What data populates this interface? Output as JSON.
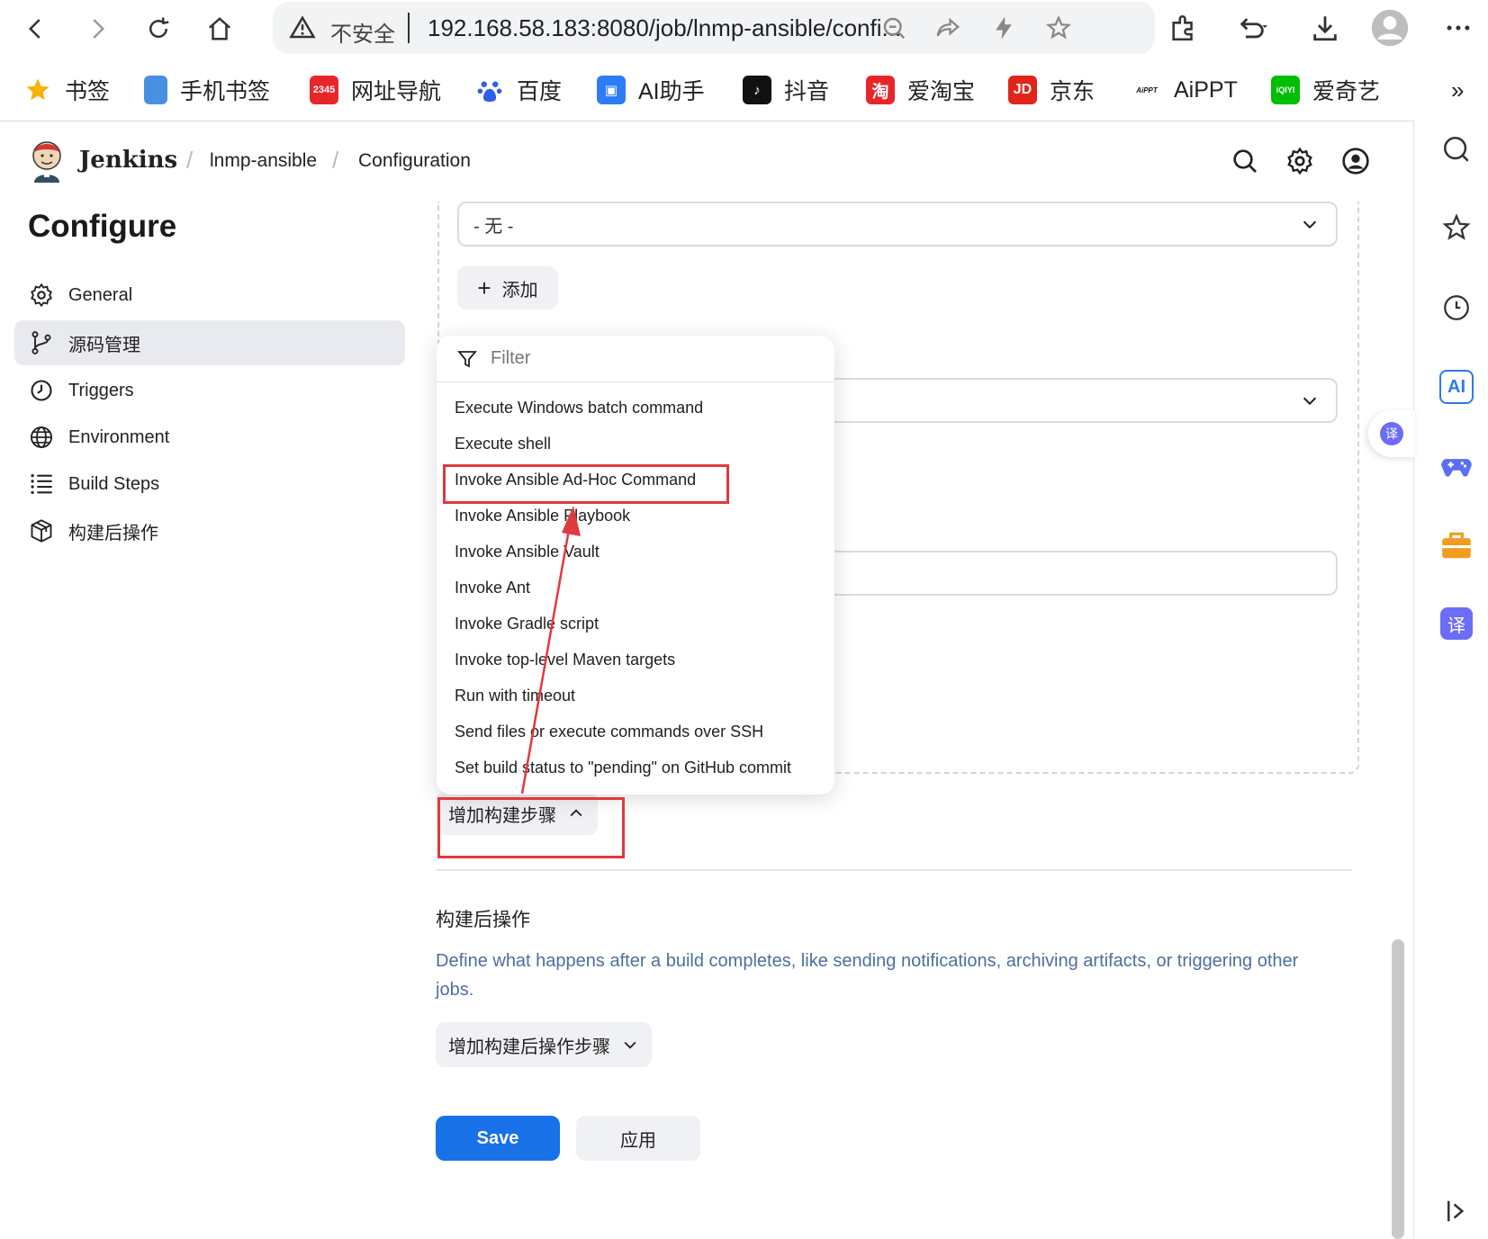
{
  "browser": {
    "insecure_label": "不安全",
    "url": "192.168.58.183:8080/job/lnmp-ansible/confi...",
    "bookmarks": [
      {
        "label": "书签",
        "icon": "star-icon"
      },
      {
        "label": "手机书签",
        "icon": "phone-icon"
      },
      {
        "label": "网址导航",
        "icon": "nav-icon",
        "badge": "2345"
      },
      {
        "label": "百度",
        "icon": "baidu-icon"
      },
      {
        "label": "AI助手",
        "icon": "ai-assistant-icon"
      },
      {
        "label": "抖音",
        "icon": "douyin-icon"
      },
      {
        "label": "爱淘宝",
        "icon": "taobao-icon",
        "badge": "淘"
      },
      {
        "label": "京东",
        "icon": "jd-icon",
        "badge": "JD"
      },
      {
        "label": "AiPPT",
        "icon": "aippt-icon",
        "badge": "AiPPT"
      },
      {
        "label": "爱奇艺",
        "icon": "iqiyi-icon",
        "badge": "iQIYI"
      }
    ],
    "more_label": "»",
    "sidebar_ai_label": "AI",
    "sidebar_translate_label": "译"
  },
  "jenkins": {
    "app_name": "Jenkins",
    "breadcrumb": [
      "lnmp-ansible",
      "Configuration"
    ]
  },
  "page": {
    "title": "Configure",
    "nav": [
      {
        "label": "General",
        "icon": "gear-icon"
      },
      {
        "label": "源码管理",
        "icon": "branch-icon",
        "active": true
      },
      {
        "label": "Triggers",
        "icon": "clock-icon"
      },
      {
        "label": "Environment",
        "icon": "globe-icon"
      },
      {
        "label": "Build Steps",
        "icon": "list-icon"
      },
      {
        "label": "构建后操作",
        "icon": "package-icon"
      }
    ]
  },
  "config": {
    "credentials_select_value": "- 无 -",
    "add_button_label": "添加",
    "add_button_icon": "+",
    "add_build_step_label": "增加构建步骤",
    "post_build_title": "构建后操作",
    "post_build_desc": "Define what happens after a build completes, like sending notifications, archiving artifacts, or triggering other jobs.",
    "add_post_build_label": "增加构建后操作步骤",
    "save_label": "Save",
    "apply_label": "应用"
  },
  "menu": {
    "filter_placeholder": "Filter",
    "items": [
      "Execute Windows batch command",
      "Execute shell",
      "Invoke Ansible Ad-Hoc Command",
      "Invoke Ansible Playbook",
      "Invoke Ansible Vault",
      "Invoke Ant",
      "Invoke Gradle script",
      "Invoke top-level Maven targets",
      "Run with timeout",
      "Send files or execute commands over SSH",
      "Set build status to \"pending\" on GitHub commit"
    ],
    "highlighted": "Invoke Ansible Ad-Hoc Command"
  },
  "colors": {
    "accent": "#1971e8",
    "annotation_red": "#e0393e",
    "link_blue": "#4d6fa0"
  }
}
